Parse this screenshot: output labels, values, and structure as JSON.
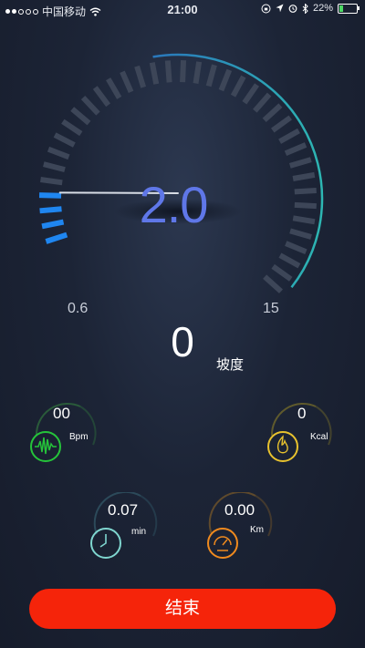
{
  "status_bar": {
    "carrier": "中国移动",
    "time": "21:00",
    "battery": "22%"
  },
  "speed_gauge": {
    "value": "2.0",
    "min_label": "0.6",
    "max_label": "15",
    "level_fraction": 0.1
  },
  "incline": {
    "value": "0",
    "label": "坡度"
  },
  "metrics": {
    "heart_rate": {
      "value": "00",
      "unit": "Bpm",
      "color": "#25c43a"
    },
    "calories": {
      "value": "0",
      "unit": "Kcal",
      "color": "#e8c22e"
    },
    "time": {
      "value": "0.07",
      "unit": "min",
      "color": "#7fd6cf"
    },
    "distance": {
      "value": "0.00",
      "unit": "Km",
      "color": "#f08a1e"
    }
  },
  "end_button": {
    "label": "结束"
  },
  "colors": {
    "accent_blue": "#1f86f0",
    "gauge_text": "#5f77e8",
    "end_button": "#f5240a"
  }
}
